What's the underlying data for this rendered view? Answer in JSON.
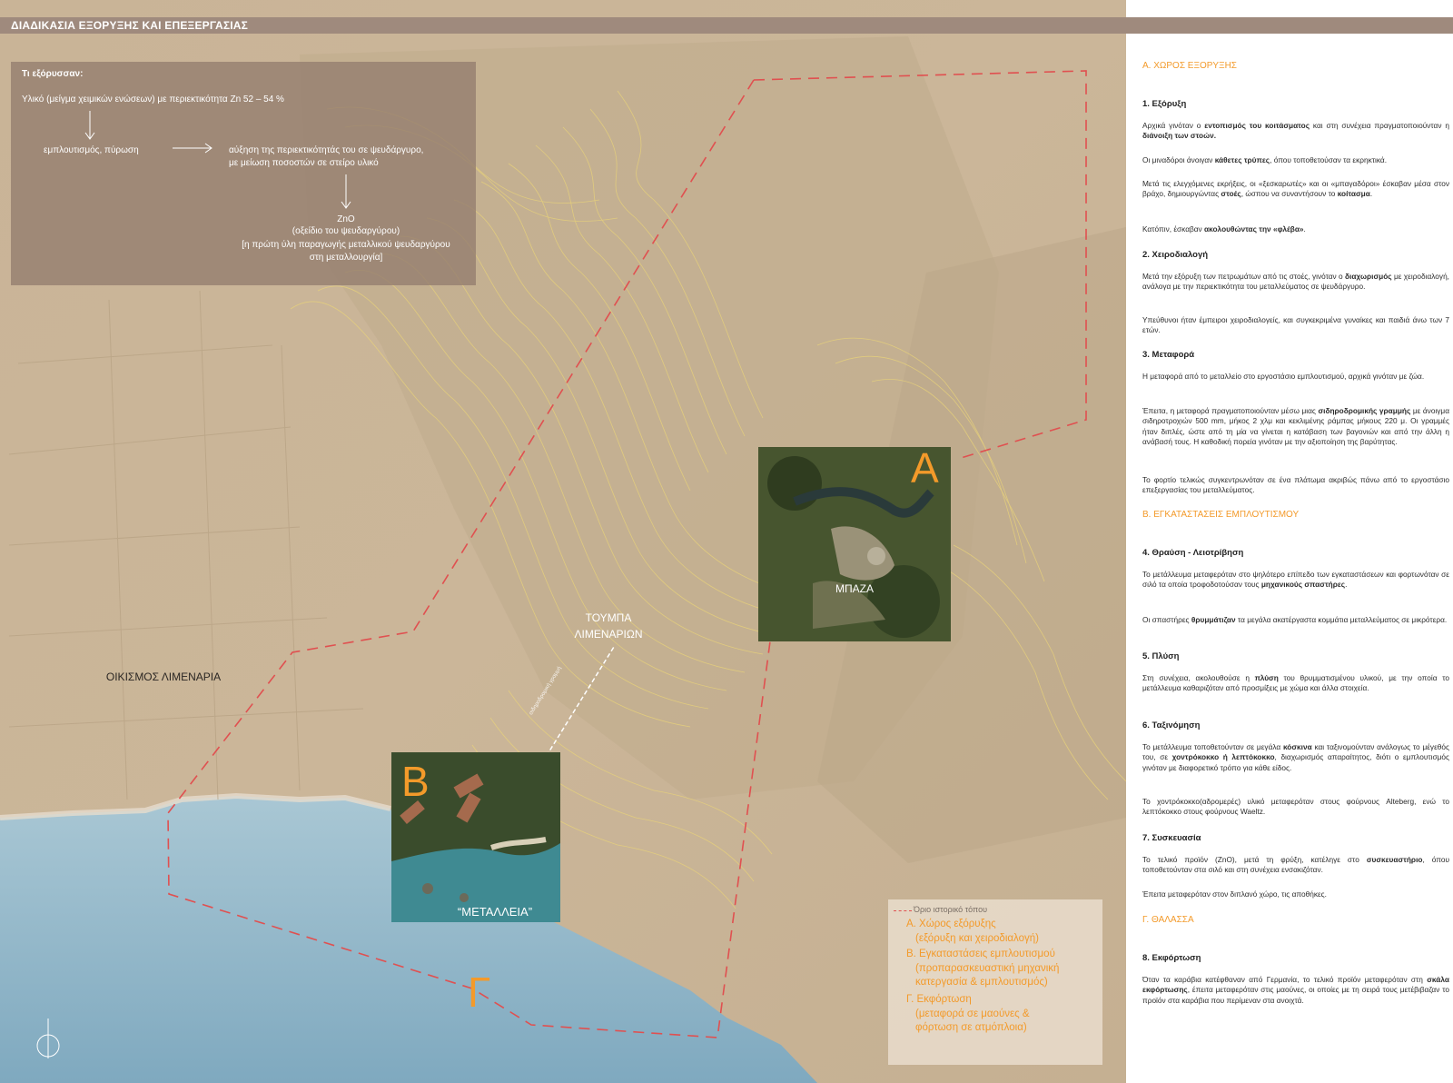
{
  "header": {
    "title": "ΔΙΑΔΙΚΑΣΙΑ ΕΞΟΡΥΞΗΣ ΚΑΙ ΕΠΕΞΕΡΓΑΣΙΑΣ"
  },
  "colors": {
    "accent": "#f39a2a",
    "boundary": "#e05050",
    "header_bar": "#9f8a7d",
    "land": "#cdb89c",
    "sea": "#8fb5c9"
  },
  "info_box": {
    "title": "Τι εξόρυσσαν:",
    "material": "Υλικό (μείγμα χειμικών ενώσεων)  με περιεκτικότητα Zn 52 – 54 %",
    "step1": "εμπλουτισμός, πύρωση",
    "step2_line1": "αύξηση της περιεκτικότητάς του σε ψευδάργυρο,",
    "step2_line2": "με μείωση ποσοστών σε στείρο υλικό",
    "product": "ZnO",
    "product_line1": "(οξείδιο του ψευδαργύρου)",
    "product_line2": "[η πρώτη ύλη παραγωγής μεταλλικού ψευδαργύρου",
    "product_line3": "στη μεταλλουργία]"
  },
  "map_labels": {
    "settlement": "ΟΙΚΙΣΜΟΣ ΛΙΜΕΝΑΡΙΑ",
    "hill_line1": "ΤΟΥΜΠΑ",
    "hill_line2": "ΛΙΜΕΝΑΡΙΩΝ",
    "site_a": "ΜΠΑΖΑ",
    "site_b": "“ΜΕΤΑΛΛΕΙΑ”",
    "rail": "σιδηροδρομική γραμμή",
    "letter_a": "Α",
    "letter_b": "Β",
    "letter_c": "Γ"
  },
  "legend": {
    "header": "Όριο ιστορικό τόπου",
    "items": [
      [
        "Α. Χώρος εξόρυξης",
        "(εξόρυξη και χειροδιαλογή)"
      ],
      [
        "Β. Εγκαταστάσεις εμπλουτισμού",
        "(προπαρασκευαστική μηχανική",
        "κατεργασία & εμπλουτισμός)"
      ],
      [
        "Γ. Εκφόρτωση",
        "(μεταφορά σε μαούνες &",
        "φόρτωση σε ατμόπλοια)"
      ]
    ]
  },
  "panel": {
    "secA": "Α. ΧΩΡΟΣ ΕΞΟΡΥΞΗΣ",
    "s1": "1. Εξόρυξη",
    "p1a_1": "Αρχικά γινόταν ο ",
    "p1a_b1": "εντοπισμός του κοιτάσματος",
    "p1a_2": " και στη συνέχεια πραγματοποιούνταν η ",
    "p1a_b2": "διάνοιξη των στοών.",
    "p1b_1": "Οι μιναδόροι άνοιγαν ",
    "p1b_b1": "κάθετες τρύπες",
    "p1b_2": ", όπου τοποθετούσαν τα εκρηκτικά.",
    "p1c_1": "Μετά τις ελεγχόμενες εκρήξεις, οι «ξεσκαρωτές» και οι «μπαγαδόροι» έσκαβαν μέσα στον βράχο, δημιουργώντας ",
    "p1c_b1": "στοές",
    "p1c_2": ", ώσπου να συναντήσουν το ",
    "p1c_b2": "κοίτασμα",
    "p1c_3": ".",
    "p1d_1": "Κατόπιν, έσκαβαν ",
    "p1d_b1": "ακολουθώντας την «φλέβα»",
    "p1d_2": ".",
    "s2": "2.  Χειροδιαλογή",
    "p2a_1": "Μετά την εξόρυξη των πετρωμάτων από τις στοές, γινόταν ο ",
    "p2a_b1": "διαχωρισμός",
    "p2a_2": " με χειροδιαλογή, ανάλογα με την περιεκτικότητα του μεταλλεύματος σε ψευδάργυρο.",
    "p2b": "Υπεύθυνοι ήταν έμπειροι χειροδιαλογείς, και συγκεκριμένα γυναίκες και παιδιά άνω των 7 ετών.",
    "s3": "3. Μεταφορά",
    "p3a": "Η μεταφορά από το μεταλλείο στο εργοστάσιο εμπλουτισμού, αρχικά γινόταν με ζώα.",
    "p3b_1": "Έπειτα, η μεταφορά πραγματοποιούνταν μέσω μιας ",
    "p3b_b1": "σιδηροδρομικής γραμμής",
    "p3b_2": " με άνοιγμα σιδηροτροχιών 500 mm, μήκος 2 χλμ και κεκλιμένης ράμπας μήκους 220 μ. Οι γραμμές ήταν διπλές, ώστε από τη μία να γίνεται η κατάβαση των βαγονιών και από την άλλη η ανάβασή τους. Η καθοδική πορεία γινόταν με την αξιοποίηση της βαρύτητας.",
    "p3c": "Το φορτίο τελικώς συγκεντρωνόταν σε ένα πλάτωμα ακριβώς πάνω από το εργοστάσιο επεξεργασίας του μεταλλεύματος.",
    "secB": "Β. ΕΓΚΑΤΑΣΤΑΣΕΙΣ ΕΜΠΛΟΥΤΙΣΜΟΥ",
    "s4": "4. Θραύση - Λειοτρίβηση",
    "p4a_1": "Το μετάλλευμα μεταφερόταν στο ψηλότερο επίπεδο των εγκαταστάσεων και φορτωνόταν σε σιλό τα οποία τροφοδοτούσαν τους ",
    "p4a_b1": "μηχανικούς σπαστήρες",
    "p4a_2": ".",
    "p4b_1": "Οι σπαστήρες ",
    "p4b_b1": "θρυμμάτιζαν",
    "p4b_2": " τα μεγάλα ακατέργαστα κομμάτια μεταλλεύματος σε μικρότερα.",
    "s5": "5. Πλύση",
    "p5_1": "Στη συνέχεια, ακολουθούσε η ",
    "p5_b1": "πλύση",
    "p5_2": " του θρυμματισμένου υλικού, με την οποία το μετάλλευμα καθαριζόταν από προσμίξεις με χώμα και άλλα στοιχεία.",
    "s6": "6. Ταξινόμηση",
    "p6a_1": "Το μετάλλευμα τοποθετούνταν σε μεγάλα ",
    "p6a_b1": "κόσκινα",
    "p6a_2": " και ταξινομούνταν ανάλογως το μέγεθός του, σε ",
    "p6a_b2": "χοντρόκοκκο ή λεπτόκοκκο",
    "p6a_3": ", διαχωρισμός απαραίτητος, διότι ο εμπλουτισμός γινόταν με διαφορετικό τρόπο για κάθε είδος.",
    "p6b": "Το χοντρόκοκκο(αδρομερές) υλικό μεταφερόταν στους φούρνους Alteberg, ενώ το λεπτόκοκκο στους φούρνους Waeltz.",
    "s7": "7. Συσκευασία",
    "p7a_1": "Το τελικό προϊόν (ZnO), μετά τη φρύξη, κατέληγε στο ",
    "p7a_b1": "συσκευαστήριο",
    "p7a_2": ", όπου τοποθετούνταν στα σιλό και στη συνέχεια ενσακιζόταν.",
    "p7b": "Έπειτα μεταφερόταν στον διπλανό χώρο, τις αποθήκες.",
    "secC": "Γ. ΘΑΛΑΣΣΑ",
    "s8": "8. Εκφόρτωση",
    "p8_1": "Όταν τα καράβια κατέφθαναν από Γερμανία, το τελικό προϊόν μεταφερόταν στη ",
    "p8_b1": "σκάλα εκφόρτωσης",
    "p8_2": ", έπειτα μεταφερόταν στις μαούνες, οι οποίες με τη σειρά τους μετέβιβαζαν το προϊόν στα καράβια που περίμεναν στα ανοιχτά."
  }
}
